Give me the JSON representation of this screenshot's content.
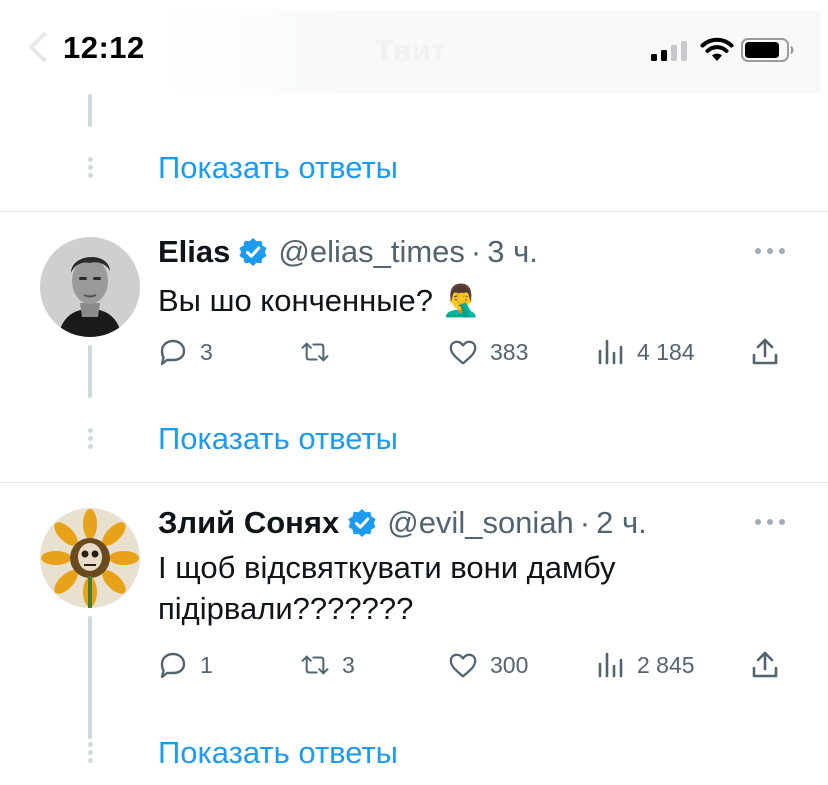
{
  "status_bar": {
    "time": "12:12",
    "nav_title": "Твит",
    "icons": [
      "signal-icon",
      "wifi-icon",
      "battery-icon"
    ]
  },
  "colors": {
    "accent": "#1d9bf0",
    "text_primary": "#0f1419",
    "text_secondary": "#536471",
    "thread_line": "#cfd9de"
  },
  "show_replies_label": "Показать ответы",
  "tweets": [
    {
      "name": "Elias",
      "verified": true,
      "handle": "@elias_times",
      "separator": "·",
      "time": "3 ч.",
      "text": "Вы шо конченные?",
      "emoji": "🤦‍♂️",
      "stats": {
        "replies": "3",
        "retweets": "",
        "likes": "383",
        "views": "4 184"
      }
    },
    {
      "name": "Злий Сонях",
      "verified": true,
      "handle": "@evil_soniah",
      "separator": "·",
      "time": "2 ч.",
      "text": "І щоб відсвяткувати вони дамбу підірвали???????",
      "stats": {
        "replies": "1",
        "retweets": "3",
        "likes": "300",
        "views": "2 845"
      }
    }
  ]
}
